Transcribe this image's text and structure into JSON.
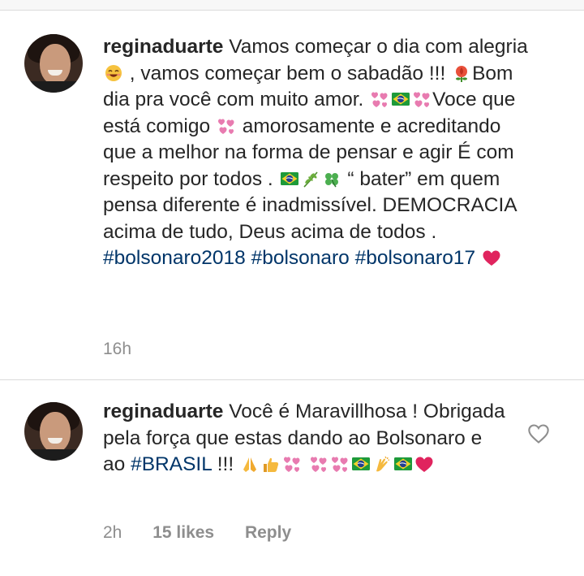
{
  "comments": [
    {
      "username": "reginaduarte",
      "segments": [
        {
          "t": "text",
          "v": " Vamos começar o dia com alegria "
        },
        {
          "t": "emoji",
          "name": "smiling-face-icon"
        },
        {
          "t": "text",
          "v": " , vamos começar bem o sabadão !!! "
        },
        {
          "t": "emoji",
          "name": "rose-icon"
        },
        {
          "t": "text",
          "v": "Bom dia pra você com muito amor. "
        },
        {
          "t": "emoji",
          "name": "hearts-icon"
        },
        {
          "t": "emoji",
          "name": "brazil-flag-icon"
        },
        {
          "t": "emoji",
          "name": "hearts-icon"
        },
        {
          "t": "text",
          "v": "Voce que está comigo "
        },
        {
          "t": "emoji",
          "name": "hearts-icon"
        },
        {
          "t": "text",
          "v": " amorosamente e acreditando que a melhor na forma de pensar e agir É com respeito por todos . "
        },
        {
          "t": "emoji",
          "name": "brazil-flag-icon"
        },
        {
          "t": "emoji",
          "name": "herb-icon"
        },
        {
          "t": "emoji",
          "name": "clover-icon"
        },
        {
          "t": "text",
          "v": " “ bater” em quem pensa diferente é inadmissível. DEMOCRACIA acima de tudo,  Deus acima de todos . "
        },
        {
          "t": "tag",
          "v": "#bolsonaro2018"
        },
        {
          "t": "text",
          "v": "  "
        },
        {
          "t": "tag",
          "v": "#bolsonaro"
        },
        {
          "t": "text",
          "v": " "
        },
        {
          "t": "tag",
          "v": "#bolsonaro17"
        },
        {
          "t": "text",
          "v": " "
        },
        {
          "t": "emoji",
          "name": "red-heart-icon"
        }
      ],
      "time": "16h",
      "likes": "",
      "reply": ""
    },
    {
      "username": "reginaduarte",
      "segments": [
        {
          "t": "text",
          "v": " Você é Maravillhosa ! Obrigada pela força que estas  dando ao Bolsonaro e ao "
        },
        {
          "t": "tag",
          "v": "#BRASIL"
        },
        {
          "t": "text",
          "v": " !!! "
        },
        {
          "t": "emoji",
          "name": "praying-hands-icon"
        },
        {
          "t": "emoji",
          "name": "thumbs-up-icon"
        },
        {
          "t": "emoji",
          "name": "hearts-icon"
        },
        {
          "t": "text",
          "v": " "
        },
        {
          "t": "emoji",
          "name": "hearts-icon"
        },
        {
          "t": "emoji",
          "name": "hearts-icon"
        },
        {
          "t": "emoji",
          "name": "brazil-flag-icon"
        },
        {
          "t": "emoji",
          "name": "clapping-hands-icon"
        },
        {
          "t": "emoji",
          "name": "brazil-flag-icon"
        },
        {
          "t": "emoji",
          "name": "red-heart-icon"
        }
      ],
      "time": "2h",
      "likes": "15 likes",
      "reply": "Reply"
    }
  ],
  "colors": {
    "text": "#262626",
    "hashtag": "#003569",
    "meta": "#8e8e8e",
    "divider": "#dbdbdb"
  }
}
